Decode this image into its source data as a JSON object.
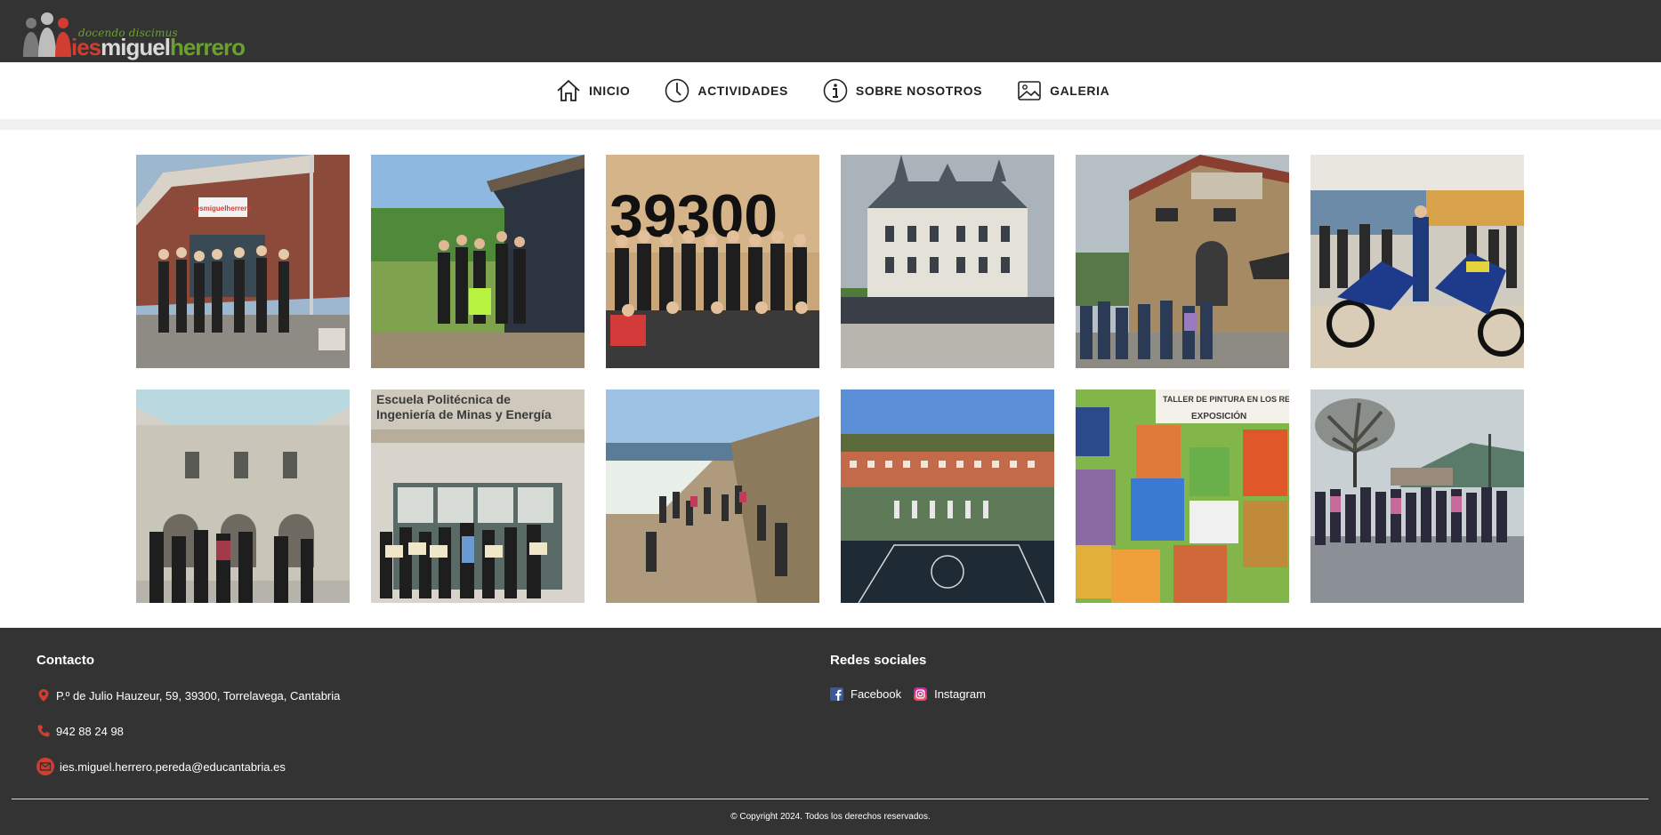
{
  "header": {
    "logo_tagline": "docendo discimus",
    "logo_part1": "ies",
    "logo_part2": "miguel",
    "logo_part3": "herrero"
  },
  "nav": {
    "items": [
      {
        "label": "INICIO",
        "icon": "home-icon"
      },
      {
        "label": "ACTIVIDADES",
        "icon": "clock-icon"
      },
      {
        "label": "SOBRE NOSOTROS",
        "icon": "info-icon"
      },
      {
        "label": "GALERIA",
        "icon": "image-icon"
      }
    ]
  },
  "gallery": {
    "photos": [
      {
        "subject": "school building entrance with group",
        "sign_text": "iesmiguelherrero"
      },
      {
        "subject": "students outdoors by wooden cabin"
      },
      {
        "subject": "group in front of 39300 sign",
        "sign_text": "39300"
      },
      {
        "subject": "students in front of castle"
      },
      {
        "subject": "students at stone building"
      },
      {
        "subject": "students with motorbikes"
      },
      {
        "subject": "students in stone courtyard"
      },
      {
        "subject": "award winners at polytechnic school",
        "sign_text": "Escuela Politécnica de Ingeniería de Minas y Energía"
      },
      {
        "subject": "students on coastal dunes"
      },
      {
        "subject": "aerial view of school yard with students"
      },
      {
        "subject": "painting exhibition wall",
        "sign_text": "TALLER DE PINTURA EN LOS RECRE",
        "sign_text2": "EXPOSICIÓN"
      },
      {
        "subject": "group photo under tree with mountains"
      }
    ]
  },
  "footer": {
    "contact_title": "Contacto",
    "address": "P.º de Julio Hauzeur, 59, 39300, Torrelavega, Cantabria",
    "phone": "942 88 24 98",
    "email": "ies.miguel.herrero.pereda@educantabria.es",
    "social_title": "Redes sociales",
    "facebook": "Facebook",
    "instagram": "Instagram",
    "copyright": "© Copyright 2024. Todos los derechos reservados."
  },
  "colors": {
    "header_bg": "#333333",
    "footer_bg": "#333333",
    "accent_red": "#d03d31",
    "accent_green": "#6aa12e",
    "facebook_blue": "#3b5998",
    "instagram_pink": "#d6249f"
  }
}
